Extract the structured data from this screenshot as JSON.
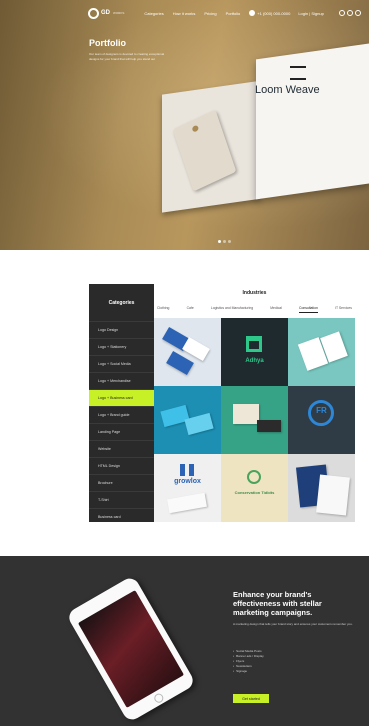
{
  "nav": {
    "logo_text": "GD",
    "logo_sub": "WORKS",
    "links": [
      "Categories",
      "How it works",
      "Pricing",
      "Portfolio"
    ],
    "phone": "+1 (000) 000-0000",
    "login": "Login | Signup"
  },
  "hero": {
    "title": "Portfolio",
    "description": "Our team of designers is devoted to creating exceptional designs for your brand that will help you stand out",
    "brand_name": "Loom Weave"
  },
  "categories": {
    "heading": "Categories",
    "items": [
      "Logo Design",
      "Logo + Stationery",
      "Logo + Social Media",
      "Logo + Merchandise",
      "Logo + Business card",
      "Logo + Brand guide",
      "Landing Page",
      "Website",
      "HTML Design",
      "Brochure",
      "T-Shirt",
      "Business card"
    ],
    "active_index": 4
  },
  "industries": {
    "heading": "Industries",
    "tabs": [
      "Clothing",
      "Cafe",
      "Logistics and Manufacturing",
      "Medical",
      "Consultation",
      "IT Services"
    ],
    "active_tab": 4
  },
  "gallery": {
    "brands": [
      "Adhya",
      "FR",
      "growlox",
      "Conservation Tidbits"
    ]
  },
  "marketing": {
    "title": "Enhance your brand's effectiveness with stellar marketing campaigns.",
    "description": "A marketing design that tells your brand story and ensures your customers remember you.",
    "list": [
      "Social Media Posts",
      "Banner ads / Display",
      "Flyers",
      "Newsletters",
      "Signage"
    ],
    "cta": "Get started"
  },
  "colors": {
    "accent": "#c8f026",
    "dark": "#2a2a2a"
  }
}
